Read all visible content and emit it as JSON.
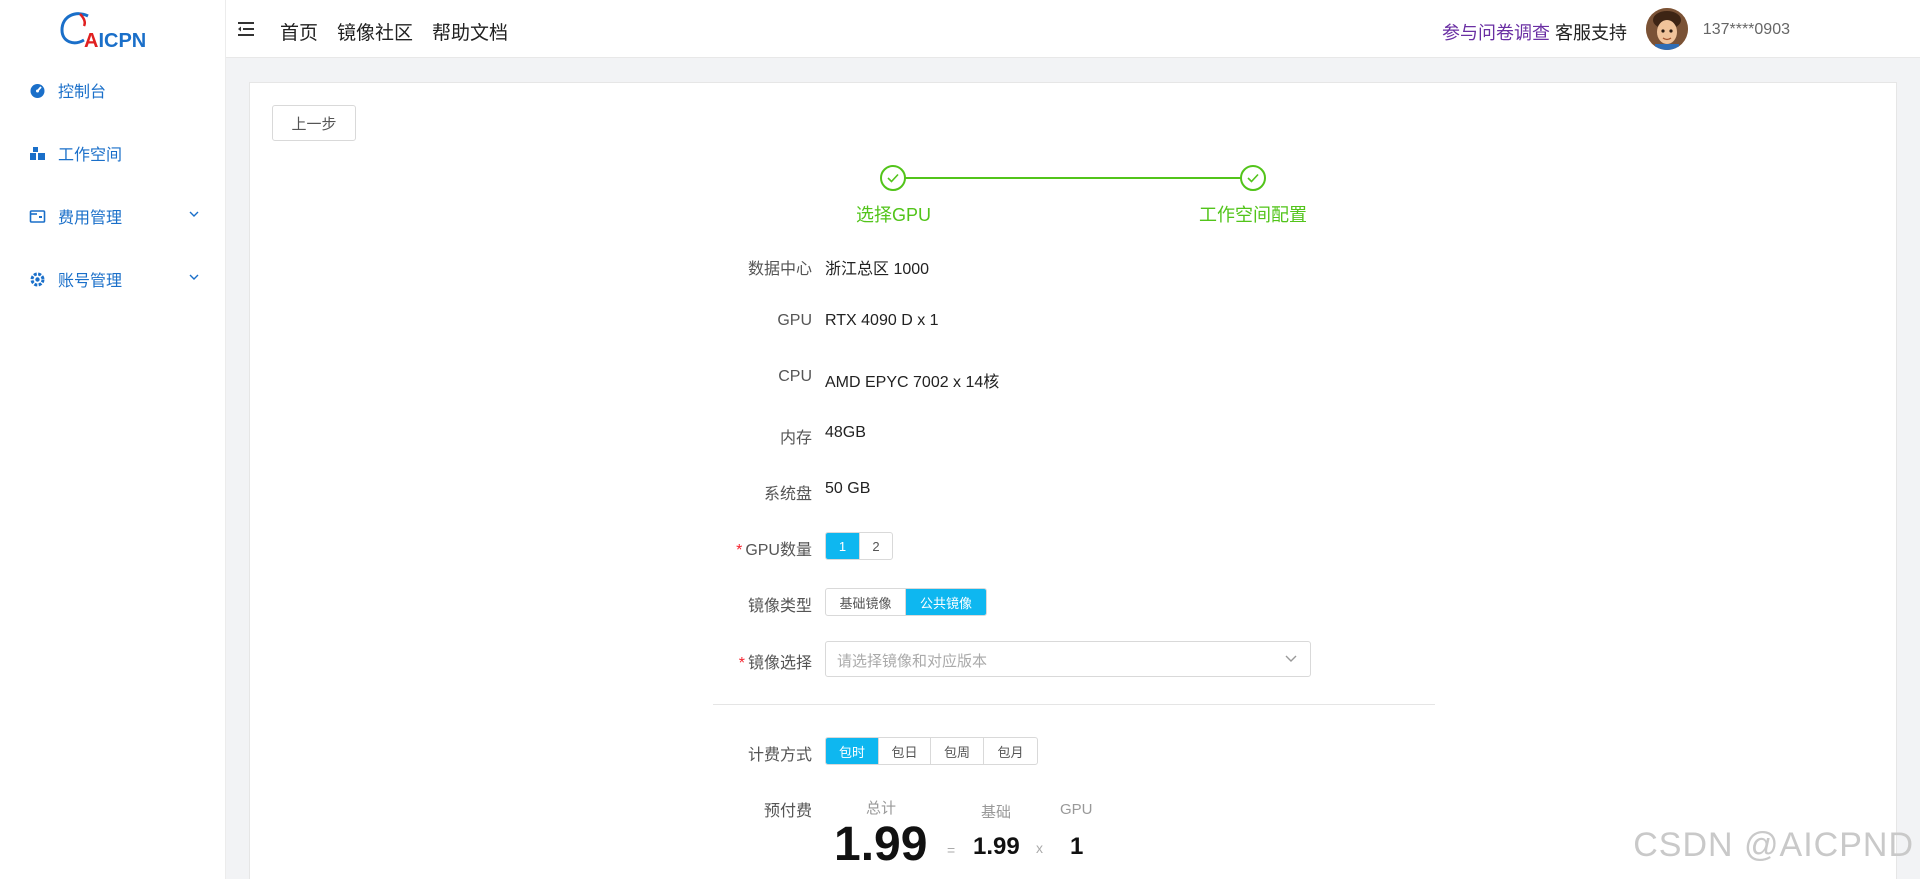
{
  "brand": {
    "logo_a": "A",
    "logo_rest": "ICPN"
  },
  "sidebar": {
    "items": [
      {
        "label": "控制台",
        "icon": "dashboard-icon"
      },
      {
        "label": "工作空间",
        "icon": "workspace-icon"
      },
      {
        "label": "费用管理",
        "icon": "billing-icon",
        "expandable": true
      },
      {
        "label": "账号管理",
        "icon": "gear-icon",
        "expandable": true
      }
    ]
  },
  "header": {
    "nav": [
      "首页",
      "镜像社区",
      "帮助文档"
    ],
    "survey": "参与问卷调查",
    "support": "客服支持",
    "user_phone": "137****0903"
  },
  "toolbar": {
    "prev_label": "上一步"
  },
  "steps": [
    {
      "label": "选择GPU",
      "status": "done"
    },
    {
      "label": "工作空间配置",
      "status": "done"
    }
  ],
  "form": {
    "datacenter": {
      "label": "数据中心",
      "value": "浙江总区 1000"
    },
    "gpu": {
      "label": "GPU",
      "value": "RTX 4090 D x 1"
    },
    "cpu": {
      "label": "CPU",
      "value": "AMD EPYC 7002 x 14核"
    },
    "memory": {
      "label": "内存",
      "value": "48GB"
    },
    "disk": {
      "label": "系统盘",
      "value": "50 GB"
    },
    "gpu_count": {
      "label": "GPU数量",
      "required": "*",
      "options": [
        "1",
        "2"
      ],
      "selected": "1"
    },
    "image_type": {
      "label": "镜像类型",
      "options": [
        "基础镜像",
        "公共镜像"
      ],
      "selected": "公共镜像"
    },
    "image_select": {
      "label": "镜像选择",
      "required": "*",
      "placeholder": "请选择镜像和对应版本"
    },
    "billing": {
      "label": "计费方式",
      "options": [
        "包时",
        "包日",
        "包周",
        "包月"
      ],
      "selected": "包时"
    }
  },
  "price": {
    "label": "预付费",
    "total_caption": "总计",
    "base_caption": "基础",
    "gpu_caption": "GPU",
    "total": "1.99",
    "equals": "=",
    "base": "1.99",
    "times": "x",
    "gpu_count": "1"
  },
  "watermark": "CSDN @AICPND",
  "colors": {
    "accent": "#0eb7f0",
    "success": "#52c41a",
    "brand_blue": "#1a6fc9",
    "brand_red": "#e02020",
    "survey": "#6a2fa3"
  }
}
